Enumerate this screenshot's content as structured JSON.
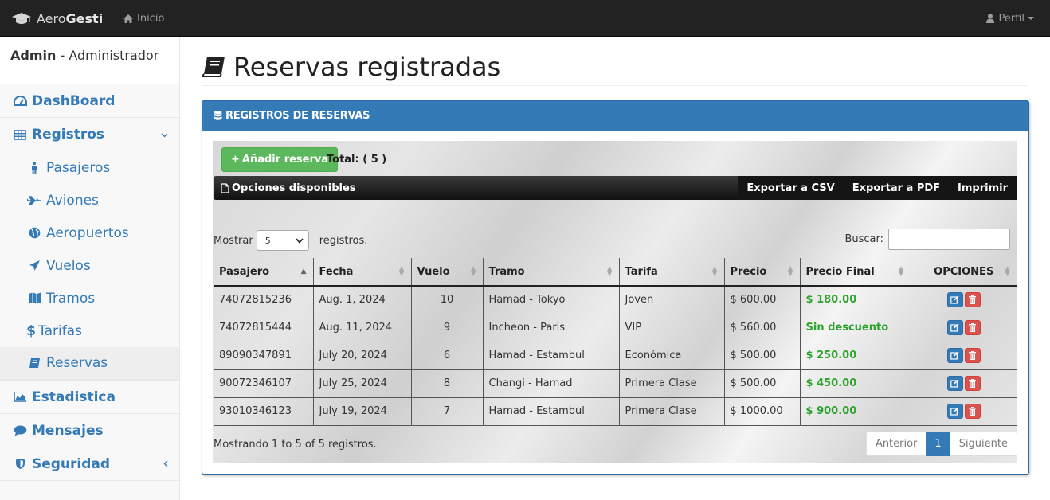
{
  "navbar": {
    "brand_light": "Aero",
    "brand_bold": "Gesti",
    "home_label": "Inicio",
    "profile_label": "Perfil"
  },
  "sidebar": {
    "user_name": "Admin",
    "user_role": " - Administrador",
    "items": [
      {
        "label": "DashBoard",
        "icon": "dashboard-icon"
      },
      {
        "label": "Registros",
        "icon": "table-icon",
        "arrow": "chevron-down-icon"
      },
      {
        "label": "Pasajeros",
        "icon": "person-icon"
      },
      {
        "label": "Aviones",
        "icon": "plane-icon"
      },
      {
        "label": "Aeropuertos",
        "icon": "globe-icon"
      },
      {
        "label": "Vuelos",
        "icon": "plane-icon"
      },
      {
        "label": "Tramos",
        "icon": "map-icon"
      },
      {
        "label": "Tarifas",
        "icon": "dollar-icon"
      },
      {
        "label": "Reservas",
        "icon": "book-icon"
      },
      {
        "label": "Estadistica",
        "icon": "area-chart-icon"
      },
      {
        "label": "Mensajes",
        "icon": "comment-icon"
      },
      {
        "label": "Seguridad",
        "icon": "shield-icon",
        "arrow": "chevron-left-icon"
      }
    ]
  },
  "page": {
    "title": "Reservas registradas",
    "panel_title": "REGISTROS DE RESERVAS",
    "add_button": "Añadir reserva",
    "total_label": "Total: ( 5 )",
    "options_title": "Opciones disponibles",
    "export_csv": "Exportar a CSV",
    "export_pdf": "Exportar a PDF",
    "print": "Imprimir",
    "show_label": "Mostrar",
    "show_value": "5",
    "records_label": "registros.",
    "search_label": "Buscar:",
    "search_value": "",
    "info": "Mostrando 1 to 5 of 5 registros.",
    "prev": "Anterior",
    "page_num": "1",
    "next": "Siguiente"
  },
  "table": {
    "columns": [
      "Pasajero",
      "Fecha",
      "Vuelo",
      "Tramo",
      "Tarifa",
      "Precio",
      "Precio Final",
      "OPCIONES"
    ],
    "rows": [
      [
        "74072815236",
        "Aug. 1, 2024",
        "10",
        "Hamad - Tokyo",
        "Joven",
        "$ 600.00",
        "$ 180.00"
      ],
      [
        "74072815444",
        "Aug. 11, 2024",
        "9",
        "Incheon - Paris",
        "VIP",
        "$ 560.00",
        "Sin descuento"
      ],
      [
        "89090347891",
        "July 20, 2024",
        "6",
        "Hamad - Estambul",
        "Económica",
        "$ 500.00",
        "$ 250.00"
      ],
      [
        "90072346107",
        "July 25, 2024",
        "8",
        "Changi - Hamad",
        "Primera Clase",
        "$ 500.00",
        "$ 450.00"
      ],
      [
        "93010346123",
        "July 19, 2024",
        "7",
        "Hamad - Estambul",
        "Primera Clase",
        "$ 1000.00",
        "$ 900.00"
      ]
    ]
  },
  "colors": {
    "primary": "#337ab7",
    "success": "#5cb85c",
    "danger": "#d9534f",
    "final_price": "#2ea32e"
  }
}
